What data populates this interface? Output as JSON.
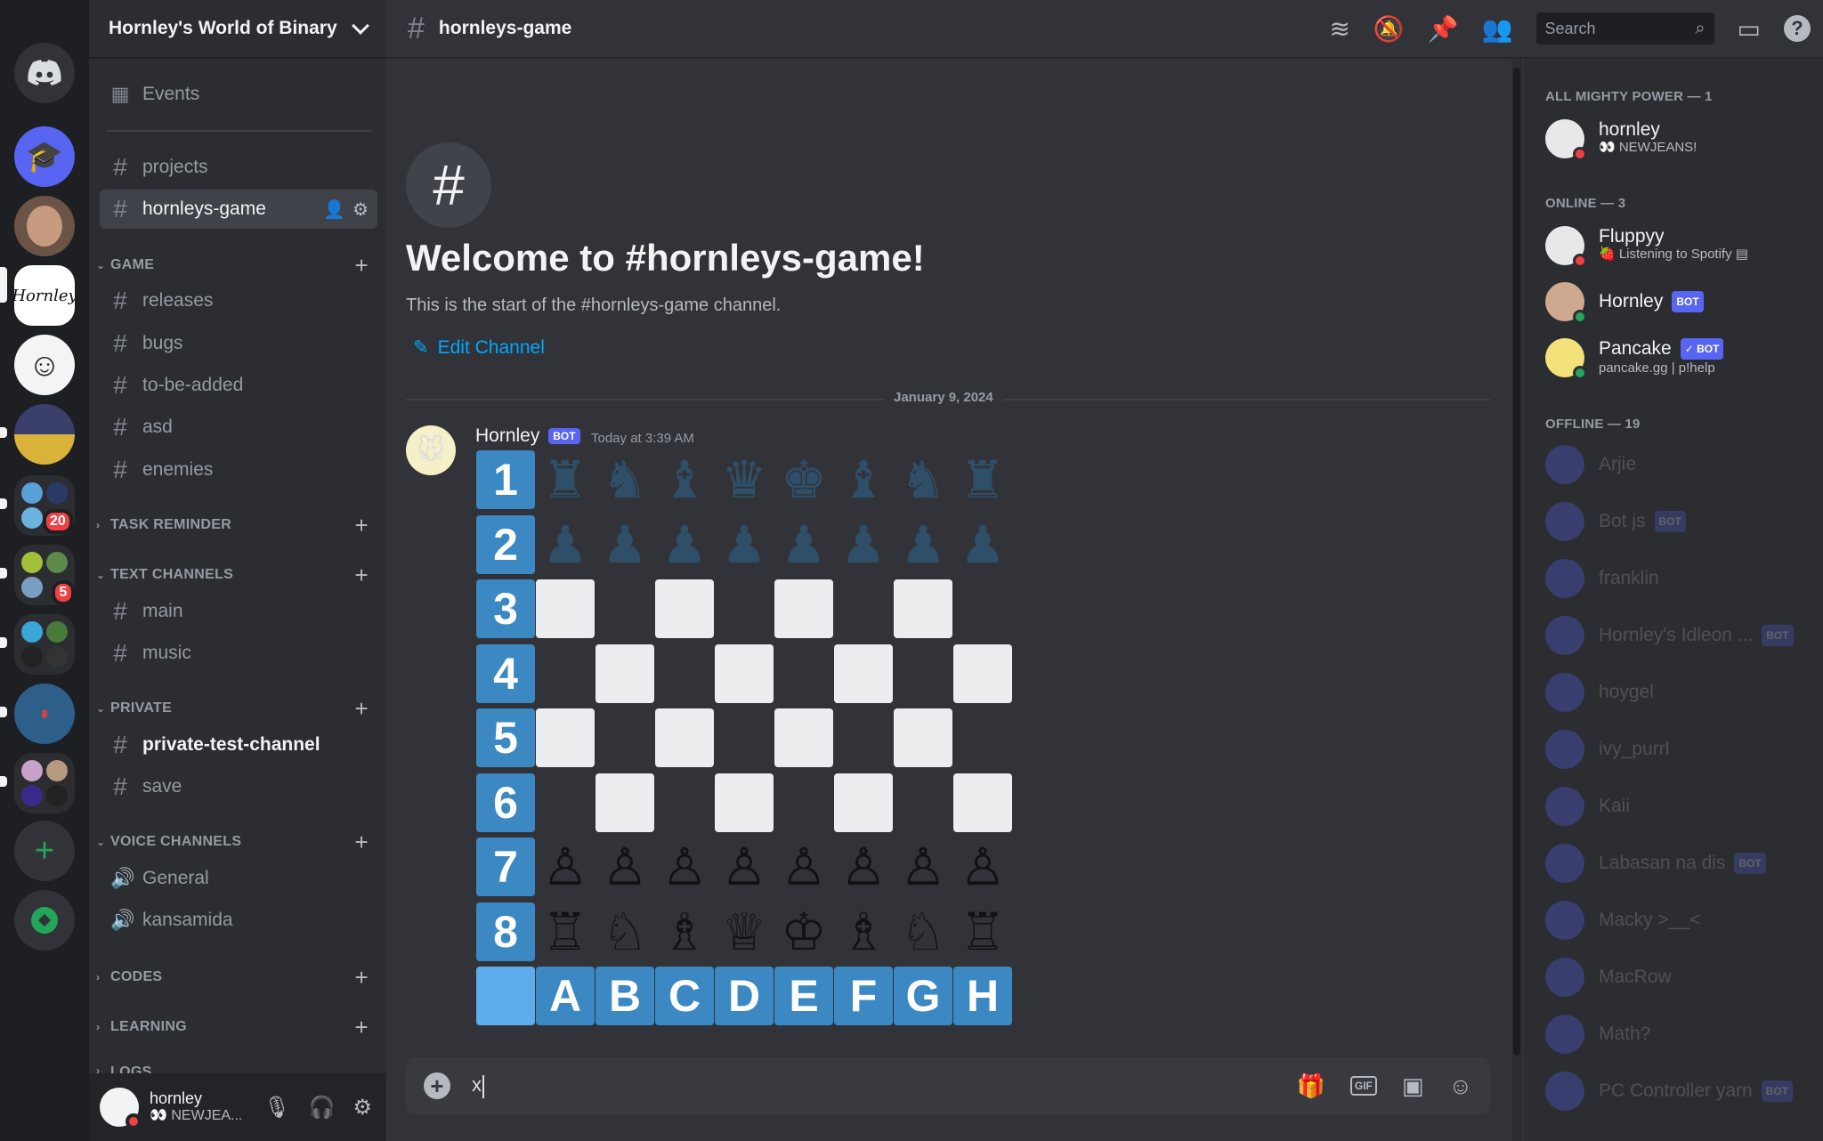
{
  "server": {
    "name": "Hornley's World of Binary",
    "badges": {
      "group1": "20",
      "group2": "5"
    }
  },
  "sidebar": {
    "events": "Events",
    "top_channels": [
      "projects",
      "hornleys-game"
    ],
    "categories": {
      "game": "GAME",
      "task_reminder": "TASK REMINDER",
      "text_channels": "TEXT CHANNELS",
      "private": "PRIVATE",
      "voice_channels": "VOICE CHANNELS",
      "codes": "CODES",
      "learning": "LEARNING",
      "logs": "LOGS"
    },
    "game_channels": [
      "releases",
      "bugs",
      "to-be-added",
      "asd",
      "enemies"
    ],
    "text_channels": [
      "main",
      "music"
    ],
    "private_channels": [
      "private-test-channel",
      "save"
    ],
    "voice_channels": [
      "General",
      "kansamida"
    ]
  },
  "user_panel": {
    "name": "hornley",
    "status": "👀 NEWJEA..."
  },
  "topbar": {
    "channel": "hornleys-game",
    "search_placeholder": "Search"
  },
  "chat": {
    "welcome_title": "Welcome to #hornleys-game!",
    "welcome_sub": "This is the start of the #hornleys-game channel.",
    "edit_channel": "Edit Channel",
    "date": "January 9, 2024",
    "message": {
      "author": "Hornley",
      "bot_tag": "BOT",
      "time": "Today at 3:39 AM",
      "board": {
        "row_labels": [
          "1",
          "2",
          "3",
          "4",
          "5",
          "6",
          "7",
          "8"
        ],
        "col_labels": [
          "A",
          "B",
          "C",
          "D",
          "E",
          "F",
          "G",
          "H"
        ],
        "rows": [
          [
            "♜",
            "♞",
            "♝",
            "♛",
            "♚",
            "♝",
            "♞",
            "♜"
          ],
          [
            "♟",
            "♟",
            "♟",
            "♟",
            "♟",
            "♟",
            "♟",
            "♟"
          ],
          [
            "",
            "",
            "",
            "",
            "",
            "",
            "",
            ""
          ],
          [
            "",
            "",
            "",
            "",
            "",
            "",
            "",
            ""
          ],
          [
            "",
            "",
            "",
            "",
            "",
            "",
            "",
            ""
          ],
          [
            "",
            "",
            "",
            "",
            "",
            "",
            "",
            ""
          ],
          [
            "♙",
            "♙",
            "♙",
            "♙",
            "♙",
            "♙",
            "♙",
            "♙"
          ],
          [
            "♖",
            "♘",
            "♗",
            "♕",
            "♔",
            "♗",
            "♘",
            "♖"
          ]
        ]
      }
    },
    "composer_value": "x"
  },
  "members": {
    "groups": {
      "power": "ALL MIGHTY POWER — 1",
      "online": "ONLINE — 3",
      "offline": "OFFLINE — 19"
    },
    "power": [
      {
        "name": "hornley",
        "sub": "👀 NEWJEANS!"
      }
    ],
    "online": [
      {
        "name": "Fluppyy",
        "sub": "🍓 Listening to Spotify ▤"
      },
      {
        "name": "Hornley",
        "tag": "BOT"
      },
      {
        "name": "Pancake",
        "tag": "✓ BOT",
        "sub": "pancake.gg | p!help"
      }
    ],
    "offline": [
      {
        "name": "Arjie"
      },
      {
        "name": "Bot js",
        "tag": "BOT"
      },
      {
        "name": "franklin"
      },
      {
        "name": "Hornley's Idleon ...",
        "tag": "BOT"
      },
      {
        "name": "hoygel"
      },
      {
        "name": "ivy_purrl"
      },
      {
        "name": "Kaii"
      },
      {
        "name": "Labasan na dis",
        "tag": "BOT"
      },
      {
        "name": "Macky >__<"
      },
      {
        "name": "MacRow"
      },
      {
        "name": "Math?"
      },
      {
        "name": "PC Controller yarn",
        "tag": "BOT"
      }
    ]
  },
  "colors": {
    "accent": "#5865f2",
    "link": "#00a8fc",
    "online": "#23a55a",
    "dnd": "#f23f43",
    "board_label": "#3b88c3"
  }
}
